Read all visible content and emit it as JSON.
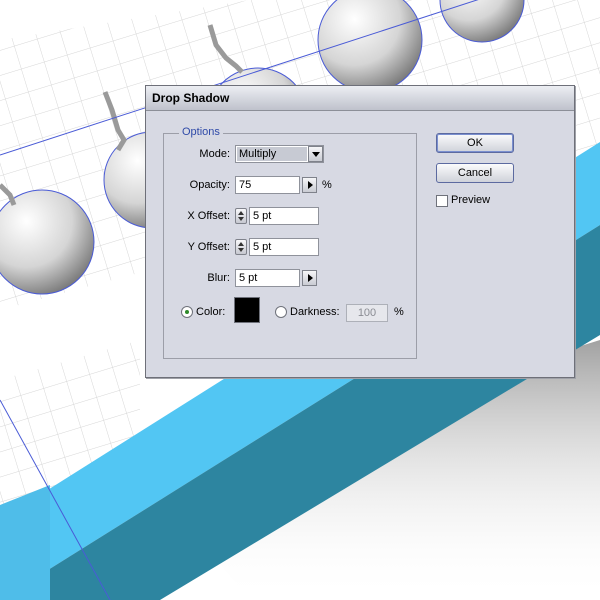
{
  "dialog": {
    "title": "Drop Shadow",
    "group_label": "Options",
    "mode": {
      "label": "Mode:",
      "value": "Multiply"
    },
    "opacity": {
      "label": "Opacity:",
      "value": "75",
      "unit": "%"
    },
    "x_offset": {
      "label": "X Offset:",
      "value": "5 pt"
    },
    "y_offset": {
      "label": "Y Offset:",
      "value": "5 pt"
    },
    "blur": {
      "label": "Blur:",
      "value": "5 pt"
    },
    "color_option": {
      "label": "Color:",
      "selected": true,
      "swatch": "#000000"
    },
    "darkness_option": {
      "label": "Darkness:",
      "value": "100",
      "unit": "%",
      "selected": false
    },
    "ok_label": "OK",
    "cancel_label": "Cancel",
    "preview_label": "Preview"
  },
  "colors": {
    "dialog_bg": "#d7d9e3",
    "accent_blue": "#52c6f3",
    "dark_teal": "#2d85a0",
    "guide_line": "#4a5bd6"
  }
}
